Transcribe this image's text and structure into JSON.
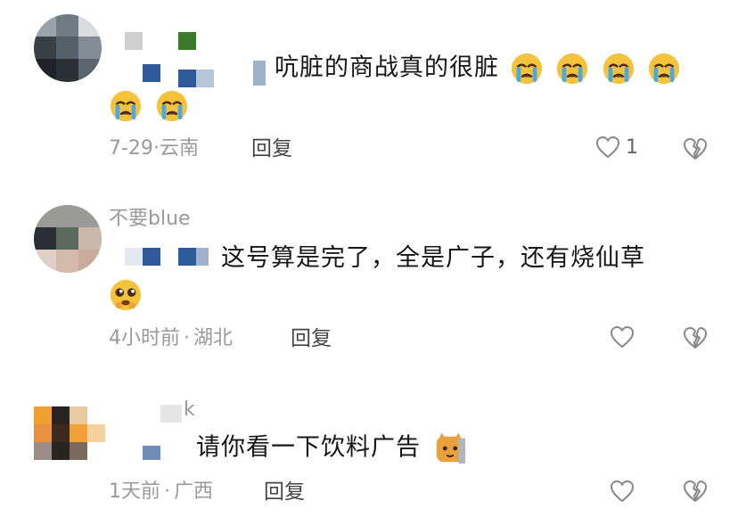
{
  "comments": [
    {
      "text_line1": "吭脏的商战真的很脏",
      "time": "7-29",
      "sep": "·",
      "location": "云南",
      "reply": "回复",
      "like_count": "1",
      "emoji_line1": [
        "crying-face",
        "crying-face",
        "crying-face",
        "crying-face"
      ],
      "emoji_line2": [
        "crying-face",
        "crying-face"
      ]
    },
    {
      "username": "不要blue",
      "text_line1": "这号算是完了，全是广子，还有烧仙草",
      "time": "4小时前",
      "sep": "·",
      "location": "湖北",
      "reply": "回复",
      "like_count": "",
      "emoji_line2": [
        "pleading-face"
      ]
    },
    {
      "username": "k",
      "text_line1": "请你看一下饮料广告",
      "time": "1天前",
      "sep": "·",
      "location": "广西",
      "reply": "回复",
      "like_count": "",
      "emoji_inline": [
        "cat-face"
      ]
    }
  ],
  "colors": {
    "text": "#161616",
    "meta": "#9a9a9a",
    "icon": "#888888",
    "crying_face": "#f5c23b",
    "tears": "#4aa8e8",
    "pixel_blue": "#2e5a9a",
    "pixel_green": "#3b7a2a"
  }
}
